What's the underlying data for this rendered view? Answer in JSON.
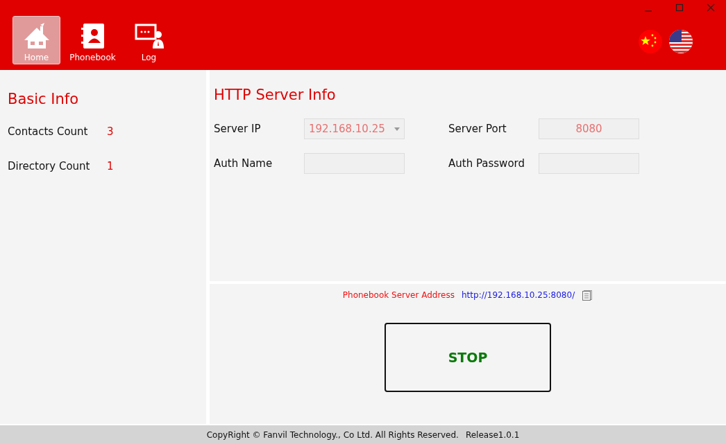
{
  "nav": [
    {
      "label": "Home",
      "selected": true
    },
    {
      "label": "Phonebook",
      "selected": false
    },
    {
      "label": "Log",
      "selected": false
    }
  ],
  "basic_info": {
    "title": "Basic Info",
    "rows": [
      {
        "label": "Contacts Count",
        "value": "3"
      },
      {
        "label": "Directory Count",
        "value": "1"
      }
    ]
  },
  "http_server": {
    "title": "HTTP Server Info",
    "fields": [
      {
        "label": "Server IP",
        "kind": "dropdown",
        "value": "192.168.10.25"
      },
      {
        "label": "Server Port",
        "kind": "input",
        "value": "8080"
      },
      {
        "label": "Auth Name",
        "kind": "input"
      },
      {
        "label": "Auth Password",
        "kind": "input"
      }
    ]
  },
  "server_address": {
    "label": "Phonebook Server Address",
    "url": "http://192.168.10.25:8080/"
  },
  "stop_button": "STOP",
  "status_bar": {
    "copyright": "CopyRight © Fanvil Technology., Co Ltd. All Rights Reserved.",
    "release": "Release1.0.1"
  }
}
